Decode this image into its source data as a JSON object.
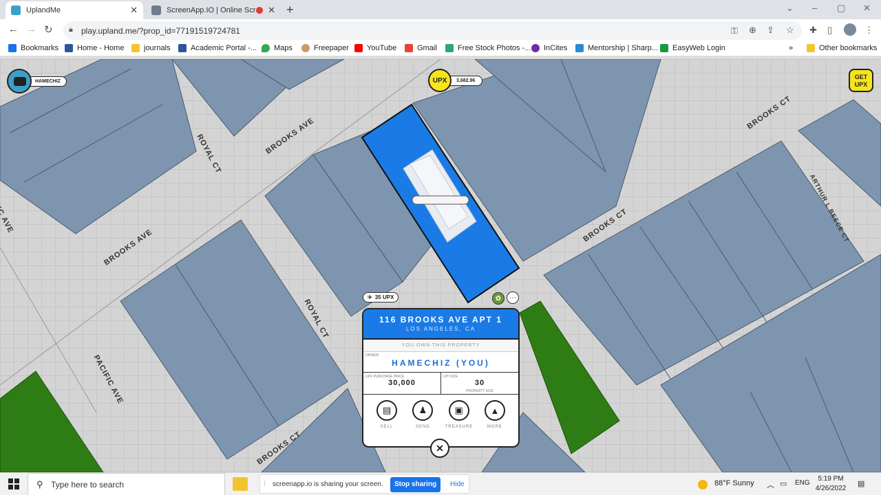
{
  "browser": {
    "tabs": [
      {
        "label": "UplandMe",
        "close": "✕"
      },
      {
        "label": "ScreenApp.IO | Online Screen",
        "close": "✕"
      }
    ],
    "new_tab": "+",
    "url": "play.upland.me/?prop_id=77191519724781",
    "bookmarks": [
      {
        "label": "Bookmarks",
        "color": "#1a73e8"
      },
      {
        "label": "Home - Home",
        "color": "#2b579a"
      },
      {
        "label": "journals",
        "color": "#f4c430"
      },
      {
        "label": "Academic Portal -...",
        "color": "#2b579a"
      },
      {
        "label": "Maps",
        "color": "#34a853"
      },
      {
        "label": "Freepaper",
        "color": "#c89c6a"
      },
      {
        "label": "YouTube",
        "color": "#ff0000"
      },
      {
        "label": "Gmail",
        "color": "#ea4335"
      },
      {
        "label": "Free Stock Photos -...",
        "color": "#2aa875"
      },
      {
        "label": "InCites",
        "color": "#6b2fa3"
      },
      {
        "label": "Mentorship | Sharp...",
        "color": "#2a8bd0"
      },
      {
        "label": "EasyWeb Login",
        "color": "#1a9a3a"
      }
    ],
    "more_bookmarks": "»",
    "other_bookmarks": "Other bookmarks"
  },
  "game": {
    "username": "HAMECHIZ",
    "upx_coin": "UPX",
    "upx_balance": "3,682.96",
    "get_upx": "GET UPX",
    "streets": [
      "ROYAL CT",
      "BROOKS AVE",
      "BROOKS CT",
      "BROOKS CT",
      "ARTHUR L BEECE CT",
      "BROOKS AVE",
      "ROYAL CT",
      "PACIFIC AVE",
      "BROOKS CT",
      "IC AVE"
    ],
    "property": {
      "upx_tag": "35 UPX",
      "title": "116 BROOKS AVE APT 1",
      "city": "LOS ANGELES, CA",
      "status": "YOU OWN THIS PROPERTY",
      "owner_caption": "OWNER",
      "owner": "HAMECHIZ (YOU)",
      "price_caption": "UPX PURCHASE PRICE",
      "price": "30,000",
      "size_caption": "UP² SIZE",
      "size": "30",
      "size_sub": "PROPERTY SIZE",
      "actions": [
        {
          "label": "SELL",
          "icon": "sell-icon"
        },
        {
          "label": "SEND",
          "icon": "send-icon"
        },
        {
          "label": "TREASURE",
          "icon": "treasure-icon"
        },
        {
          "label": "MORE",
          "icon": "more-icon"
        }
      ],
      "close": "✕"
    },
    "colors": {
      "selected": "#1a7be6",
      "parcel": "#7e95b0",
      "owned_green": "#2e7d14",
      "upx_yellow": "#f7e51b"
    }
  },
  "taskbar": {
    "search_placeholder": "Type here to search",
    "share_text": "screenapp.io is sharing your screen.",
    "stop_sharing": "Stop sharing",
    "hide": "Hide",
    "weather": "88°F  Sunny",
    "lang": "ENG",
    "time": "5:19 PM",
    "date": "4/26/2022"
  }
}
